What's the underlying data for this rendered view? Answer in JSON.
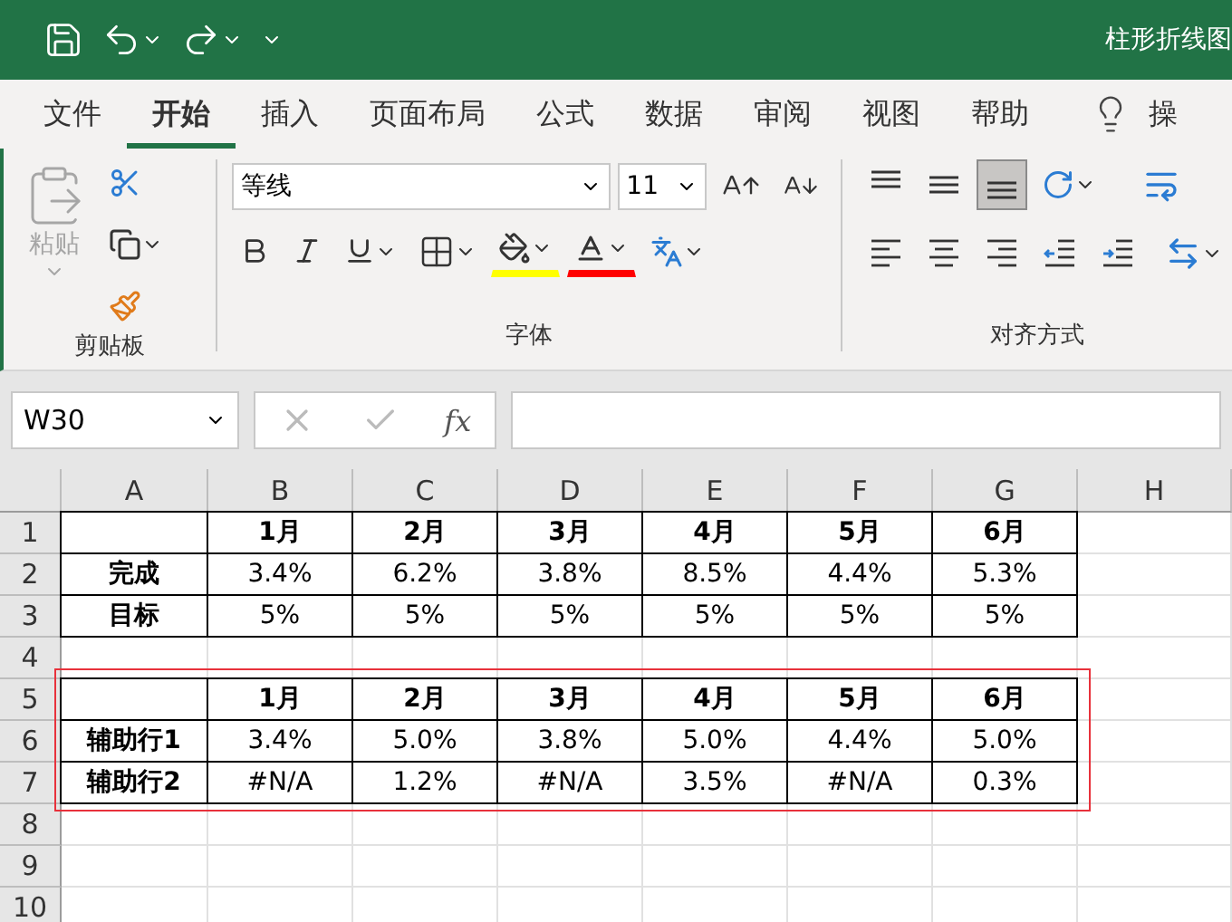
{
  "window": {
    "title": "柱形折线图"
  },
  "tabs": [
    {
      "label": "文件",
      "selected": false
    },
    {
      "label": "开始",
      "selected": true
    },
    {
      "label": "插入",
      "selected": false
    },
    {
      "label": "页面布局",
      "selected": false
    },
    {
      "label": "公式",
      "selected": false
    },
    {
      "label": "数据",
      "selected": false
    },
    {
      "label": "审阅",
      "selected": false
    },
    {
      "label": "视图",
      "selected": false
    },
    {
      "label": "帮助",
      "selected": false
    }
  ],
  "tell_me": {
    "label": "操"
  },
  "ribbon": {
    "clipboard": {
      "paste": {
        "label": "粘贴",
        "disabled": true
      },
      "group_label": "剪贴板"
    },
    "font": {
      "font_name": "等线",
      "font_size": "11",
      "group_label": "字体"
    },
    "alignment": {
      "group_label": "对齐方式",
      "vertical": [
        {
          "kind": "top",
          "selected": false
        },
        {
          "kind": "middle",
          "selected": false
        },
        {
          "kind": "bottom",
          "selected": true
        }
      ],
      "horizontal": [
        {
          "kind": "left"
        },
        {
          "kind": "center"
        },
        {
          "kind": "right"
        },
        {
          "kind": "outdent"
        },
        {
          "kind": "indent"
        }
      ]
    }
  },
  "formula_bar": {
    "name_box": "W30",
    "fx": "fx"
  },
  "sheet": {
    "columns": [
      "A",
      "B",
      "C",
      "D",
      "E",
      "F",
      "G",
      "H"
    ],
    "rows": [
      {
        "number": "1",
        "kind": "header",
        "highlighted": false,
        "values": [
          "1月",
          "2月",
          "3月",
          "4月",
          "5月",
          "6月"
        ]
      },
      {
        "number": "2",
        "kind": "data",
        "highlighted": false,
        "label": "完成",
        "values": [
          "3.4%",
          "6.2%",
          "3.8%",
          "8.5%",
          "4.4%",
          "5.3%"
        ]
      },
      {
        "number": "3",
        "kind": "data",
        "highlighted": false,
        "label": "目标",
        "values": [
          "5%",
          "5%",
          "5%",
          "5%",
          "5%",
          "5%"
        ]
      },
      {
        "number": "4",
        "kind": "empty",
        "highlighted": false
      },
      {
        "number": "5",
        "kind": "header",
        "highlighted": true,
        "values": [
          "1月",
          "2月",
          "3月",
          "4月",
          "5月",
          "6月"
        ]
      },
      {
        "number": "6",
        "kind": "data",
        "highlighted": true,
        "label": "辅助行1",
        "values": [
          "3.4%",
          "5.0%",
          "3.8%",
          "5.0%",
          "4.4%",
          "5.0%"
        ]
      },
      {
        "number": "7",
        "kind": "data",
        "highlighted": true,
        "label": "辅助行2",
        "values": [
          "#N/A",
          "1.2%",
          "#N/A",
          "3.5%",
          "#N/A",
          "0.3%"
        ]
      },
      {
        "number": "8",
        "kind": "empty",
        "highlighted": false
      },
      {
        "number": "9",
        "kind": "empty",
        "highlighted": false
      },
      {
        "number": "10",
        "kind": "empty",
        "highlighted": false
      }
    ]
  }
}
